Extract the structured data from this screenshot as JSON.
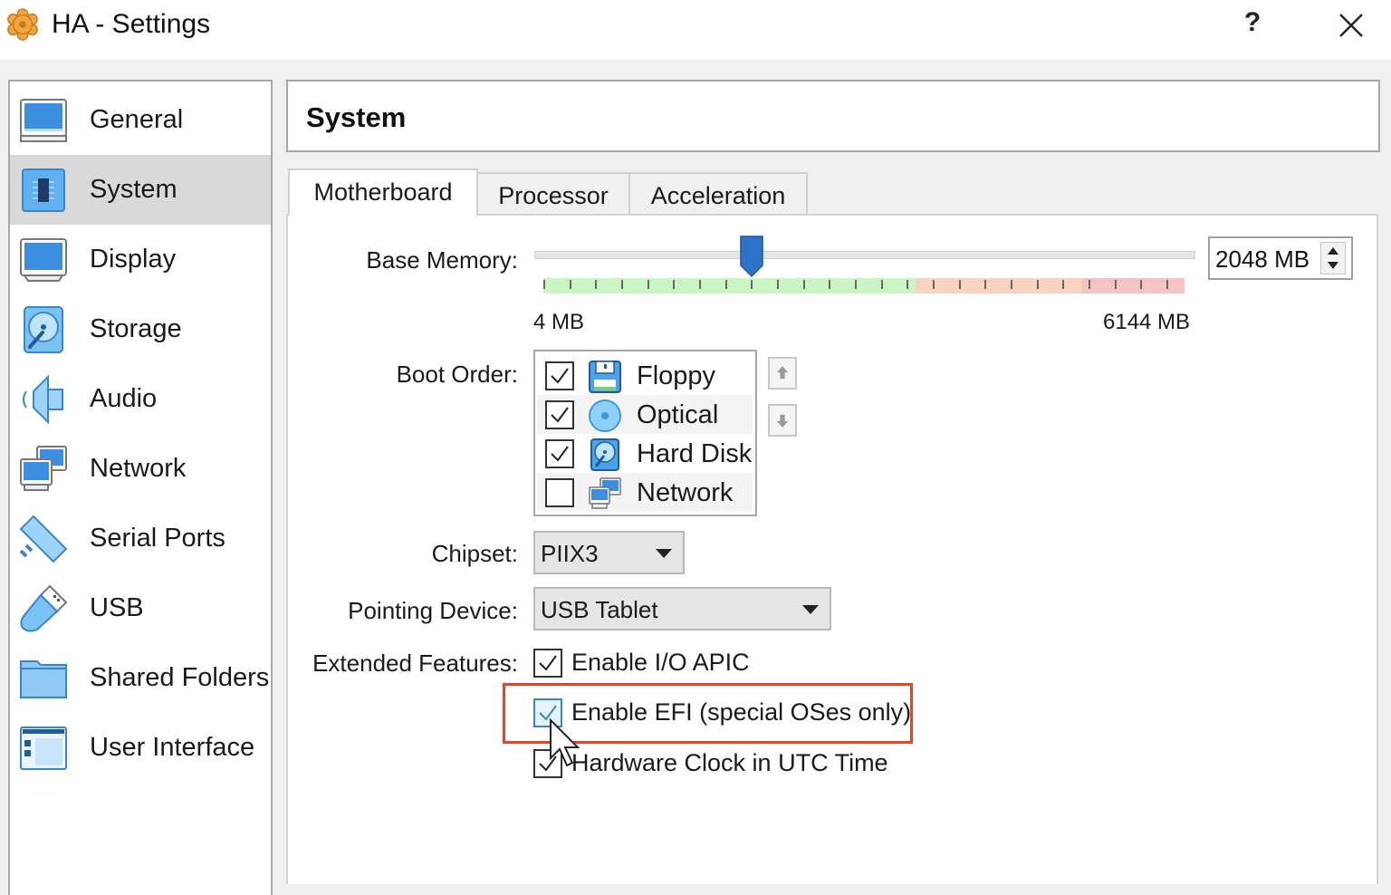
{
  "window": {
    "title": "HA - Settings",
    "help_label": "?",
    "icons": {
      "app": "virtualbox-gear-icon",
      "close": "close-icon"
    }
  },
  "sidebar": {
    "selected": "System",
    "items": [
      {
        "label": "General",
        "icon": "general-monitor-icon"
      },
      {
        "label": "System",
        "icon": "system-chip-icon"
      },
      {
        "label": "Display",
        "icon": "display-monitor-icon"
      },
      {
        "label": "Storage",
        "icon": "storage-disk-icon"
      },
      {
        "label": "Audio",
        "icon": "audio-speaker-icon"
      },
      {
        "label": "Network",
        "icon": "network-monitors-icon"
      },
      {
        "label": "Serial Ports",
        "icon": "serial-port-icon"
      },
      {
        "label": "USB",
        "icon": "usb-icon"
      },
      {
        "label": "Shared Folders",
        "icon": "folder-icon"
      },
      {
        "label": "User Interface",
        "icon": "user-interface-icon"
      }
    ]
  },
  "header": {
    "title": "System"
  },
  "tabs": [
    {
      "label": "Motherboard",
      "active": true
    },
    {
      "label": "Processor",
      "active": false
    },
    {
      "label": "Acceleration",
      "active": false
    }
  ],
  "motherboard": {
    "base_memory": {
      "label": "Base Memory:",
      "value_mb": 2048,
      "value_text": "2048 MB",
      "min_label": "4 MB",
      "max_label": "6144 MB",
      "min_mb": 4,
      "max_mb": 6144,
      "zones": {
        "green_until_fraction": 0.58,
        "orange_until_fraction": 0.84
      },
      "colors": {
        "green": "#ccf5c4",
        "orange": "#f8d3c0",
        "red": "#f5c3c3",
        "thumb": "#2f72c9"
      }
    },
    "boot_order": {
      "label": "Boot Order:",
      "items": [
        {
          "label": "Floppy",
          "checked": true,
          "icon": "floppy-icon"
        },
        {
          "label": "Optical",
          "checked": true,
          "icon": "optical-disc-icon"
        },
        {
          "label": "Hard Disk",
          "checked": true,
          "icon": "hard-disk-icon"
        },
        {
          "label": "Network",
          "checked": false,
          "icon": "network-icon"
        }
      ],
      "move_up": "move-up-icon",
      "move_down": "move-down-icon"
    },
    "chipset": {
      "label": "Chipset:",
      "value": "PIIX3"
    },
    "pointing_device": {
      "label": "Pointing Device:",
      "value": "USB Tablet"
    },
    "extended_features": {
      "label": "Extended Features:",
      "items": [
        {
          "label": "Enable I/O APIC",
          "checked": true
        },
        {
          "label": "Enable EFI (special OSes only)",
          "checked": true,
          "highlighted": true
        },
        {
          "label": "Hardware Clock in UTC Time",
          "checked": true
        }
      ],
      "highlight_color": "#e5432c"
    }
  }
}
